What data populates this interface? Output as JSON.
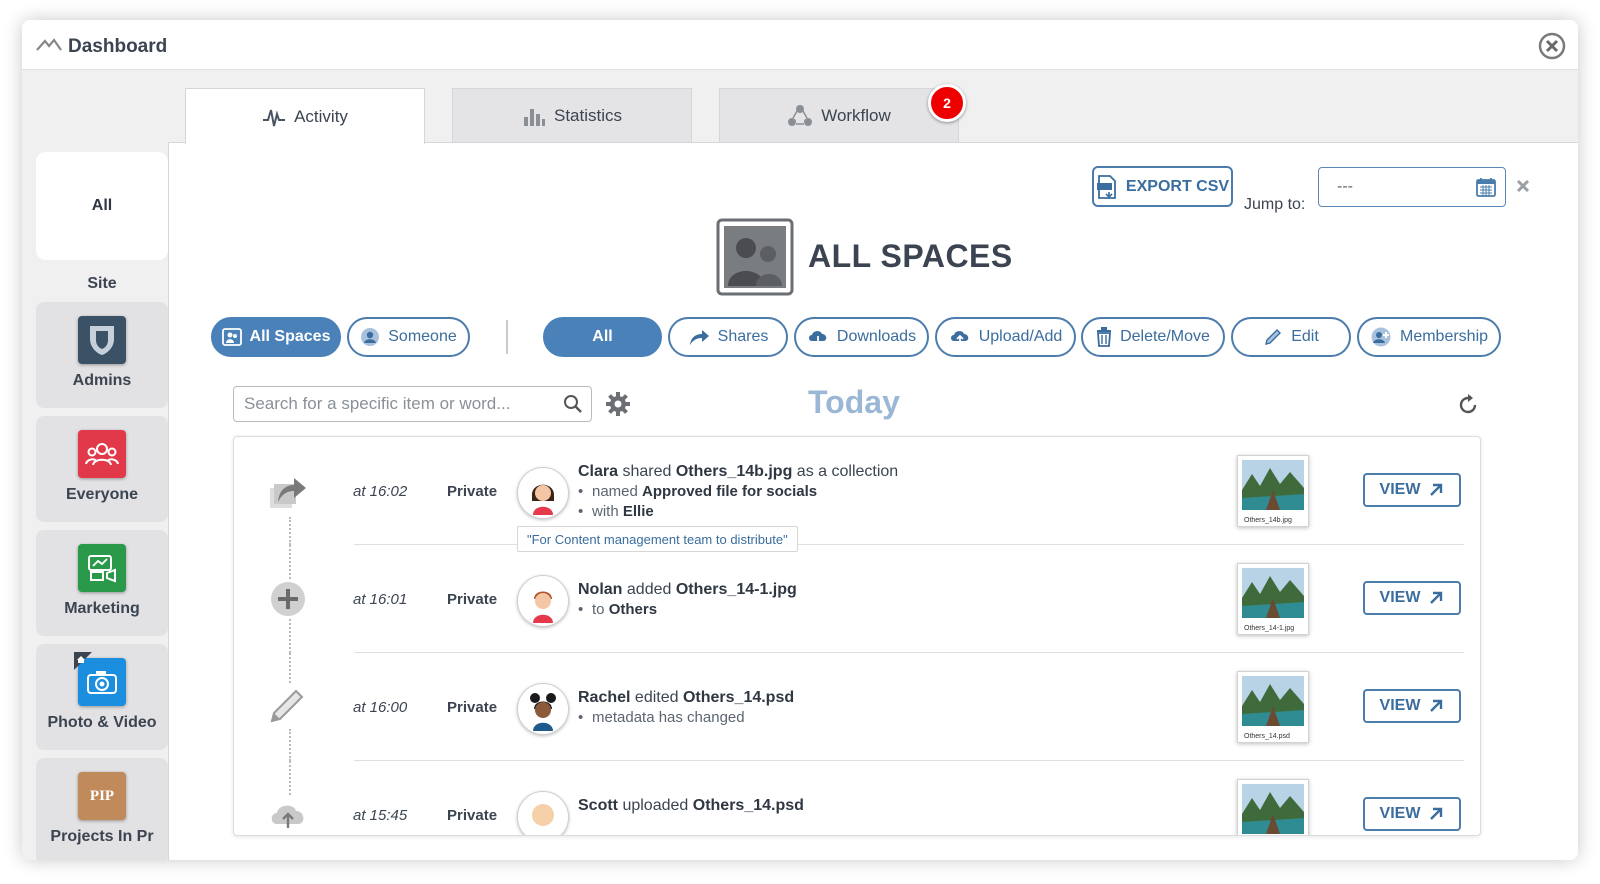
{
  "window": {
    "title": "Dashboard"
  },
  "tabs": [
    {
      "label": "Activity",
      "icon": "activity-pulse-icon"
    },
    {
      "label": "Statistics",
      "icon": "bar-chart-icon"
    },
    {
      "label": "Workflow",
      "icon": "workflow-icon",
      "badge": "2"
    }
  ],
  "sidebar": {
    "all_label": "All",
    "site_label": "Site",
    "spaces": [
      {
        "label": "Admins",
        "icon": "shield-icon",
        "color": "#3b5266"
      },
      {
        "label": "Everyone",
        "icon": "people-icon",
        "color": "#e2394a"
      },
      {
        "label": "Marketing",
        "icon": "marketing-icon",
        "color": "#2a9a4a"
      },
      {
        "label": "Photo & Video",
        "icon": "camera-icon",
        "color": "#1c8ee0"
      },
      {
        "label": "Projects In Pr",
        "icon": "pip-icon",
        "badge_text": "PIP",
        "color": "#c08a5a"
      }
    ]
  },
  "toolbar": {
    "export_label": "EXPORT CSV",
    "jump_label": "Jump to:",
    "date_value": "---"
  },
  "heading": "ALL SPACES",
  "scope_filters": [
    {
      "label": "All Spaces",
      "active": true
    },
    {
      "label": "Someone",
      "active": false
    }
  ],
  "type_filters": [
    {
      "label": "All",
      "active": true
    },
    {
      "label": "Shares"
    },
    {
      "label": "Downloads"
    },
    {
      "label": "Upload/Add"
    },
    {
      "label": "Delete/Move"
    },
    {
      "label": "Edit"
    },
    {
      "label": "Membership"
    }
  ],
  "search": {
    "placeholder": "Search for a specific item or word..."
  },
  "date_group": "Today",
  "activities": [
    {
      "time": "at 16:02",
      "visibility": "Private",
      "user": "Clara",
      "verb": "shared",
      "item": "Others_14b.jpg",
      "suffix": "as a collection",
      "details": [
        {
          "prefix": "named",
          "value": "Approved file for socials"
        },
        {
          "prefix": "with",
          "value": "Ellie"
        }
      ],
      "note": "\"For Content management team to distribute\"",
      "thumb_caption": "Others_14b.jpg",
      "view_label": "VIEW"
    },
    {
      "time": "at 16:01",
      "visibility": "Private",
      "user": "Nolan",
      "verb": "added",
      "item": "Others_14-1.jpg",
      "suffix": "",
      "details": [
        {
          "prefix": "to",
          "value": "Others"
        }
      ],
      "thumb_caption": "Others_14-1.jpg",
      "view_label": "VIEW"
    },
    {
      "time": "at 16:00",
      "visibility": "Private",
      "user": "Rachel",
      "verb": "edited",
      "item": "Others_14.psd",
      "suffix": "",
      "details": [
        {
          "prefix": "metadata has changed",
          "value": ""
        }
      ],
      "thumb_caption": "Others_14.psd",
      "view_label": "VIEW"
    },
    {
      "time": "at 15:45",
      "visibility": "Private",
      "user": "Scott",
      "verb": "uploaded",
      "item": "Others_14.psd",
      "suffix": "",
      "details": [],
      "thumb_caption": "",
      "view_label": "VIEW"
    }
  ]
}
